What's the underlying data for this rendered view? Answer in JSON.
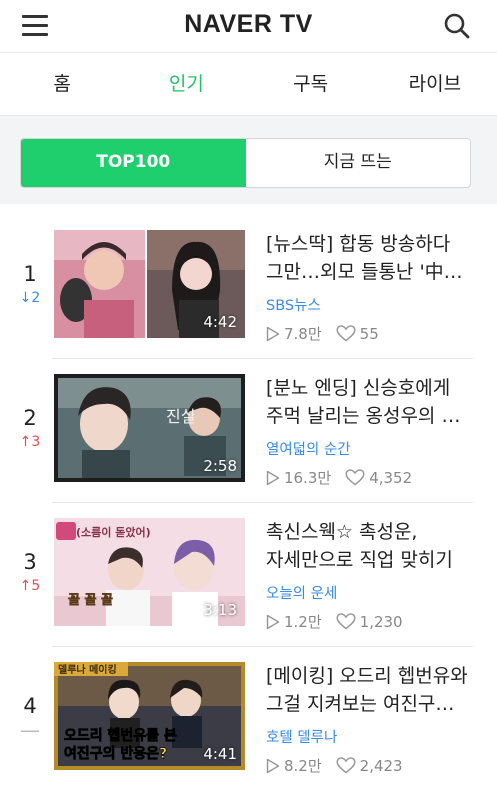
{
  "header": {
    "logo": "NAVER TV",
    "menu_icon": "hamburger-icon",
    "search_icon": "search-icon"
  },
  "tabs": [
    {
      "label": "홈",
      "active": false
    },
    {
      "label": "인기",
      "active": true
    },
    {
      "label": "구독",
      "active": false
    },
    {
      "label": "라이브",
      "active": false
    }
  ],
  "segment": {
    "top100": "TOP100",
    "trending": "지금 뜨는",
    "active": "top100"
  },
  "colors": {
    "accent": "#1fce6d",
    "rank_down": "#3a8be5",
    "rank_up": "#e84a4a",
    "channel": "#3a8be5"
  },
  "videos": [
    {
      "rank": "1",
      "change": "↓2",
      "change_dir": "down",
      "title": "[뉴스딱] 합동 방송하다 그만…외모 들통난 '中…",
      "channel": "SBS뉴스",
      "views": "7.8만",
      "likes": "55",
      "duration": "4:42"
    },
    {
      "rank": "2",
      "change": "↑3",
      "change_dir": "up",
      "title": "[분노 엔딩] 신승호에게 주먹 날리는 옹성우의 …",
      "channel": "열여덟의 순간",
      "views": "16.3만",
      "likes": "4,352",
      "duration": "2:58",
      "thumb_text": "진실"
    },
    {
      "rank": "3",
      "change": "↑5",
      "change_dir": "up",
      "title": "촉신스웩☆ 촉성운, 자세만으로 직업 맞히기 성…",
      "channel": "오늘의 운세",
      "views": "1.2만",
      "likes": "1,230",
      "duration": "3:13",
      "thumb_text": "(소름이 돋았어)",
      "thumb_text2": "꼴 꼴 꼴"
    },
    {
      "rank": "4",
      "change": "—",
      "change_dir": "same",
      "title": "[메이킹] 오드리 헵번유와 그걸 지켜보는 여진구…",
      "channel": "호텔 델루나",
      "views": "8.2만",
      "likes": "2,423",
      "duration": "4:41",
      "thumb_text": "델루나 메이킹",
      "thumb_text2": "오드리 헵번유를 본",
      "thumb_text3": "여진구의 반응은?"
    }
  ]
}
